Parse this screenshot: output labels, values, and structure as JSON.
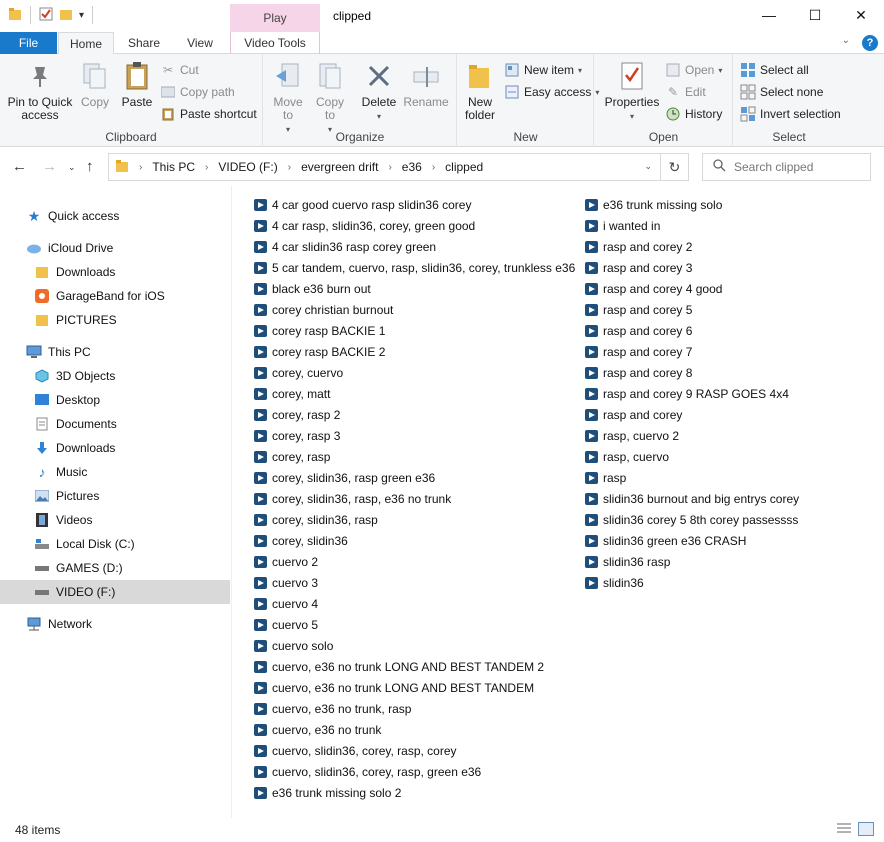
{
  "window": {
    "title": "clipped",
    "context_tab": "Play",
    "controls": {
      "minimize": "—",
      "maximize": "☐",
      "close": "✕"
    }
  },
  "tabs": [
    "File",
    "Home",
    "Share",
    "View",
    "Video Tools"
  ],
  "ribbon": {
    "clipboard": {
      "label": "Clipboard",
      "pin": "Pin to Quick access",
      "copy": "Copy",
      "paste": "Paste",
      "cut": "Cut",
      "copy_path": "Copy path",
      "paste_shortcut": "Paste shortcut"
    },
    "organize": {
      "label": "Organize",
      "move_to": "Move to",
      "copy_to": "Copy to",
      "delete": "Delete",
      "rename": "Rename"
    },
    "new": {
      "label": "New",
      "new_folder": "New folder",
      "new_item": "New item",
      "easy_access": "Easy access"
    },
    "open": {
      "label": "Open",
      "properties": "Properties",
      "open": "Open",
      "edit": "Edit",
      "history": "History"
    },
    "select": {
      "label": "Select",
      "select_all": "Select all",
      "select_none": "Select none",
      "invert": "Invert selection"
    }
  },
  "address": {
    "crumbs": [
      "This PC",
      "VIDEO (F:)",
      "evergreen drift",
      "e36",
      "clipped"
    ],
    "search_placeholder": "Search clipped"
  },
  "nav": {
    "quick_access": "Quick access",
    "icloud": "iCloud Drive",
    "icloud_items": [
      "Downloads",
      "GarageBand for iOS",
      "PICTURES"
    ],
    "this_pc": "This PC",
    "pc_items": [
      "3D Objects",
      "Desktop",
      "Documents",
      "Downloads",
      "Music",
      "Pictures",
      "Videos",
      "Local Disk (C:)",
      "GAMES (D:)",
      "VIDEO (F:)"
    ],
    "network": "Network"
  },
  "files_col1": [
    "4 car good cuervo rasp slidin36 corey",
    "4 car rasp, slidin36, corey, green good",
    "4 car slidin36 rasp corey green",
    "5 car tandem, cuervo, rasp, slidin36, corey, trunkless e36",
    "black e36 burn out",
    "corey christian burnout",
    "corey rasp BACKIE 1",
    "corey rasp BACKIE 2",
    "corey, cuervo",
    "corey, matt",
    "corey, rasp 2",
    "corey, rasp 3",
    "corey, rasp",
    "corey, slidin36, rasp green e36",
    "corey, slidin36, rasp, e36 no trunk",
    "corey, slidin36, rasp",
    "corey, slidin36",
    "cuervo 2",
    "cuervo 3",
    "cuervo 4",
    "cuervo 5",
    "cuervo solo",
    "cuervo, e36 no trunk LONG AND BEST TANDEM 2",
    "cuervo, e36 no trunk LONG AND BEST TANDEM",
    "cuervo, e36 no trunk, rasp",
    "cuervo, e36 no trunk",
    "cuervo, slidin36, corey, rasp, corey",
    "cuervo, slidin36, corey, rasp, green e36",
    "e36 trunk missing solo 2"
  ],
  "files_col2": [
    "e36 trunk missing solo",
    "i wanted in",
    "rasp and corey 2",
    "rasp and corey 3",
    "rasp and corey 4 good",
    "rasp and corey 5",
    "rasp and corey 6",
    "rasp and corey 7",
    "rasp and corey 8",
    "rasp and corey 9 RASP GOES 4x4",
    "rasp and corey",
    "rasp, cuervo 2",
    "rasp, cuervo",
    "rasp",
    "slidin36 burnout and big entrys corey",
    "slidin36 corey 5 8th corey passessss",
    "slidin36 green e36 CRASH",
    "slidin36 rasp",
    "slidin36"
  ],
  "status": {
    "count": "48 items"
  }
}
